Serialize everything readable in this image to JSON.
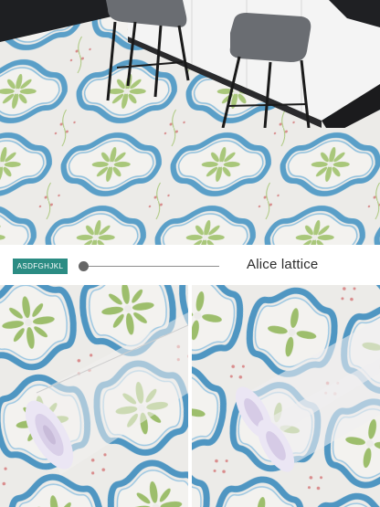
{
  "brand": {
    "label": "ASDFGHJKL"
  },
  "pattern": {
    "name": "Alice lattice"
  },
  "colors": {
    "tile_blue": "#5a9fc8",
    "tile_blue_dark": "#3f86b4",
    "tile_green": "#a9c77a",
    "tile_bg": "#ecebe8",
    "badge": "#2b8c83",
    "cabinet": "#f4f4f4",
    "chair": "#6a6d72"
  },
  "scenes": {
    "hero": "kitchen-floor-with-bar-stools",
    "left_photo": "rolled-wallpaper-closeup",
    "right_photo": "two-rolled-wallpaper-sheets"
  }
}
